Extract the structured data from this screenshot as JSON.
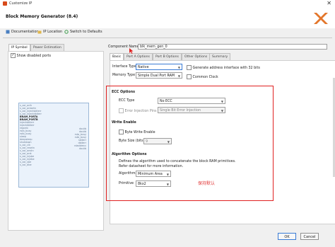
{
  "window": {
    "title": "Customize IP",
    "close": "✕"
  },
  "header": {
    "title": "Block Memory Generator (8.4)"
  },
  "toolbar": {
    "documentation": "Documentation",
    "ip_location": "IP Location",
    "switch_defaults": "Switch to Defaults"
  },
  "left_panel": {
    "tabs": [
      "IP Symbol",
      "Power Estimation"
    ],
    "show_disabled_ports": "Show disabled ports",
    "show_disabled_checked": true,
    "left_pins": [
      "s_axi_aclk",
      "s_axi_aresetn",
      "s_axi_injectsbiterr",
      "s_axi_injectdbiterr",
      "BRAM_PORTA",
      "BRAM_PORTB",
      "injectsbiterr",
      "injectdbiterr",
      "regceb",
      "rsta_busy",
      "rstb_busy",
      "sleep",
      "deepsleep",
      "shutdown",
      "s_axi_clk",
      "s_axi_resetn",
      "s_axi_wrstn",
      "s_axi_arst",
      "s_axi_injsbe",
      "s_axi_injdbe",
      "s_axi_sbe",
      "s_axi_dbe"
    ],
    "right_pins": [
      "doutb",
      "doutb",
      "rsta_busy",
      "rstb_busy",
      "sbiterr",
      "dbiterr",
      "rdaddrecc",
      "doutb"
    ]
  },
  "component": {
    "label": "Component Name",
    "value": "blk_mem_gen_0"
  },
  "tabs": [
    "Basic",
    "Port A Options",
    "Port B Options",
    "Other Options",
    "Summary"
  ],
  "basic": {
    "interface_type_label": "Interface Type",
    "interface_type_value": "Native",
    "memory_type_label": "Memory Type",
    "memory_type_value": "Simple Dual Port RAM",
    "gen_addr_label": "Generate address interface with 32 bits",
    "common_clock_label": "Common Clock"
  },
  "ecc": {
    "title": "ECC Options",
    "type_label": "ECC Type",
    "type_value": "No ECC",
    "error_inj_label": "Error Injection Pins",
    "error_inj_value": "Single Bit Error Injection"
  },
  "write_enable": {
    "title": "Write Enable",
    "byte_we_label": "Byte Write Enable",
    "byte_size_label": "Byte Size (bits)",
    "byte_size_value": "9"
  },
  "algorithm": {
    "title": "Algorithm Options",
    "desc1": "Defines the algorithm used to concatenate the block RAM primitives.",
    "desc2": "Refer datasheet for more information.",
    "algorithm_label": "Algorithm",
    "algorithm_value": "Minimum Area",
    "primitive_label": "Primitive",
    "primitive_value": "8kx2"
  },
  "annotation": "保持默认",
  "buttons": {
    "ok": "OK",
    "cancel": "Cancel"
  },
  "colors": {
    "highlight_box": "#e02020",
    "accent": "#3a7bd5"
  }
}
